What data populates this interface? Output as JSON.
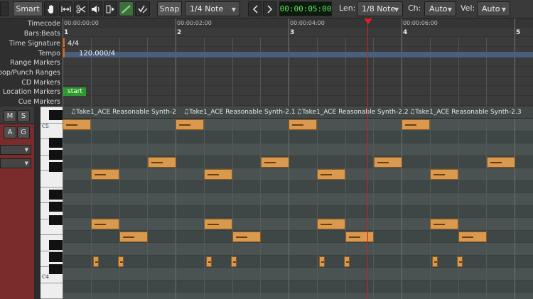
{
  "toolbar": {
    "mode_label": "Smart",
    "snap_label": "Snap",
    "grid_value": "1/4 Note",
    "clock": "00:00:05:00",
    "len_label": "Len:",
    "len_value": "1/8 Note",
    "ch_label": "Ch:",
    "ch_value": "Auto",
    "vel_label": "Vel:",
    "vel_value": "Auto",
    "tool_icons": [
      "grab-tool-icon",
      "range-tool-icon",
      "cut-tool-icon",
      "audition-tool-icon",
      "stretch-tool-icon",
      "draw-tool-icon",
      "internal-edit-tool-icon"
    ]
  },
  "ruler": {
    "labels": [
      "Timecode",
      "Bars:Beats",
      "Time Signature",
      "Tempo",
      "Range Markers",
      "Loop/Punch Ranges",
      "CD Markers",
      "Location Markers",
      "Cue Markers"
    ],
    "timecodes": [
      "00:00:00:00",
      "00:00:02:00",
      "00:00:04:00",
      "00:00:06:00"
    ],
    "bars": [
      "1",
      "2",
      "3",
      "4",
      "5"
    ],
    "time_signature": "4/4",
    "tempo": "120.000/4",
    "start_marker": "start"
  },
  "track": {
    "mute_label": "M",
    "solo_label": "S",
    "a_label": "A",
    "g_label": "G"
  },
  "keyboard": {
    "c5_label": "C5",
    "c4_label": "C4"
  },
  "region": {
    "names": [
      "♫Take1_ACE Reasonable Synth-2",
      "♫Take1_ACE Reasonable Synth-2.1",
      "♫Take1_ACE Reasonable Synth-2.2",
      "♫Take1_ACE Reasonable Synth-2.3"
    ]
  },
  "colors": {
    "note_fill": "#d99a50",
    "playhead": "#d02020",
    "clock_text": "#5fe35f",
    "start_marker": "#2e9a2e",
    "track_color": "#7a2c2c"
  }
}
